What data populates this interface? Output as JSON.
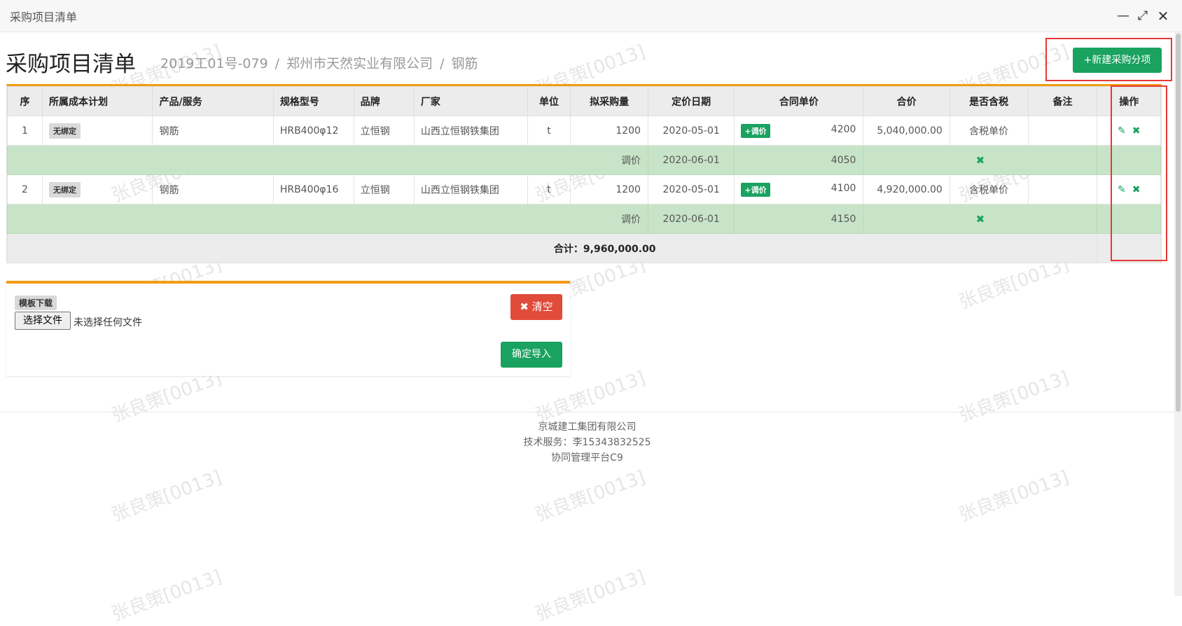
{
  "window": {
    "title": "采购项目清单"
  },
  "page": {
    "title": "采购项目清单",
    "breadcrumb": [
      "2019工01号-079",
      "郑州市天然实业有限公司",
      "钢筋"
    ],
    "new_button": "+新建采购分项"
  },
  "table": {
    "headers": [
      "序",
      "所属成本计划",
      "产品/服务",
      "规格型号",
      "品牌",
      "厂家",
      "单位",
      "拟采购量",
      "定价日期",
      "合同单价",
      "合价",
      "是否含税",
      "备注",
      "操作"
    ],
    "rows": [
      {
        "seq": "1",
        "plan": "无绑定",
        "product": "钢筋",
        "spec": "HRB400φ12",
        "brand": "立恒钢",
        "maker": "山西立恒钢铁集团",
        "unit": "t",
        "qty": "1200",
        "date": "2020-05-01",
        "adjust_badge": "+调价",
        "price": "4200",
        "amount": "5,040,000.00",
        "tax": "含税单价",
        "note": "",
        "sub": {
          "label": "调价",
          "date": "2020-06-01",
          "price": "4050"
        }
      },
      {
        "seq": "2",
        "plan": "无绑定",
        "product": "钢筋",
        "spec": "HRB400φ16",
        "brand": "立恒钢",
        "maker": "山西立恒钢铁集团",
        "unit": "t",
        "qty": "1200",
        "date": "2020-05-01",
        "adjust_badge": "+调价",
        "price": "4100",
        "amount": "4,920,000.00",
        "tax": "含税单价",
        "note": "",
        "sub": {
          "label": "调价",
          "date": "2020-06-01",
          "price": "4150"
        }
      }
    ],
    "total": "合计：9,960,000.00"
  },
  "upload": {
    "template_label": "模板下载",
    "file_button": "选择文件",
    "file_status": "未选择任何文件",
    "clear_button": "✖ 清空",
    "confirm_button": "确定导入"
  },
  "footer": {
    "company": "京城建工集团有限公司",
    "support": "技术服务：李15343832525",
    "platform": "协同管理平台C9"
  },
  "watermark": "张良策[0013]",
  "colors": {
    "accent": "#1aa260",
    "danger": "#e04b3a",
    "orange": "#f39c12",
    "subrow": "#c8e4c8"
  }
}
